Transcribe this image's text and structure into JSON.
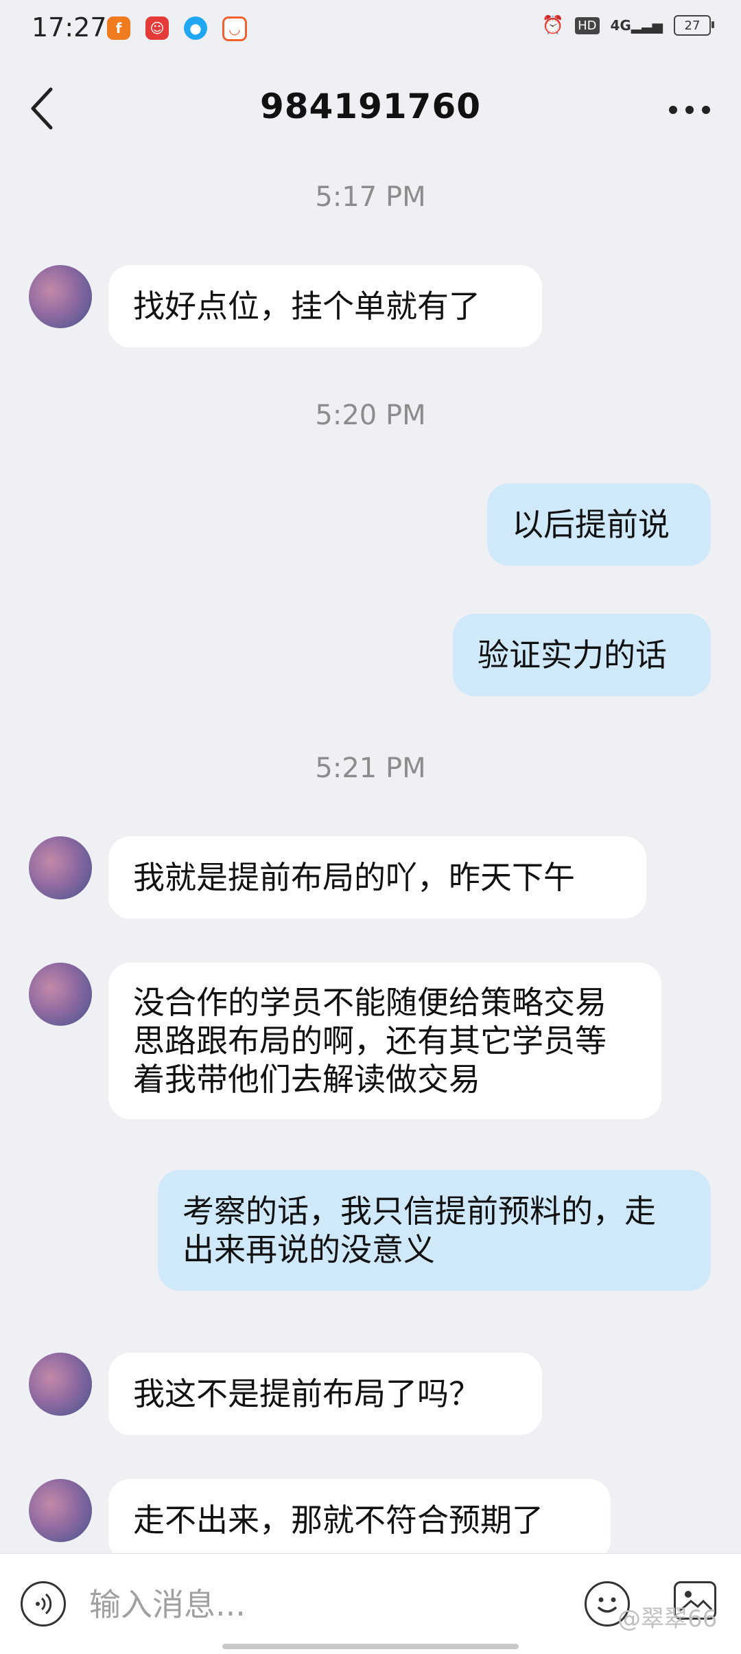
{
  "status_bar": {
    "time": "17:27",
    "notifications": [
      {
        "icon": "fire-app-icon",
        "color": "#f07b1f"
      },
      {
        "icon": "mascot-app-icon",
        "color": "#e43a3a"
      },
      {
        "icon": "penguin-app-icon",
        "color": "#21a6f2"
      },
      {
        "icon": "chat-app-icon",
        "color": "#f06030"
      }
    ],
    "network": "4G",
    "hd_badge": "HD",
    "battery": "27"
  },
  "header": {
    "title": "984191760"
  },
  "messages": [
    {
      "type": "time",
      "text": "5:17 PM"
    },
    {
      "type": "in",
      "text": "找好点位，挂个单就有了"
    },
    {
      "type": "time",
      "text": "5:20 PM"
    },
    {
      "type": "out",
      "text": "以后提前说"
    },
    {
      "type": "out",
      "text": "验证实力的话"
    },
    {
      "type": "time",
      "text": "5:21 PM"
    },
    {
      "type": "in",
      "text": "我就是提前布局的吖，昨天下午"
    },
    {
      "type": "in",
      "text": "没合作的学员不能随便给策略交易思路跟布局的啊，还有其它学员等着我带他们去解读做交易"
    },
    {
      "type": "out",
      "text": "考察的话，我只信提前预料的，走出来再说的没意义"
    },
    {
      "type": "in",
      "text": "我这不是提前布局了吗？"
    },
    {
      "type": "in",
      "text": "走不出来，那就不符合预期了"
    }
  ],
  "input": {
    "placeholder": "输入消息..."
  },
  "watermark": "@翠翠66"
}
